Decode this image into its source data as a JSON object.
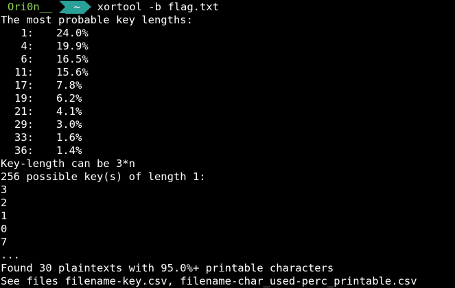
{
  "prompt": {
    "user": "Ori0n__",
    "directory": "~",
    "command": "xortool -b flag.txt"
  },
  "output": {
    "header": "The most probable key lengths:",
    "key_lengths": [
      {
        "length": "1:",
        "percent": "24.0%"
      },
      {
        "length": "4:",
        "percent": "19.9%"
      },
      {
        "length": "6:",
        "percent": "16.5%"
      },
      {
        "length": "11:",
        "percent": "15.6%"
      },
      {
        "length": "17:",
        "percent": "7.8%"
      },
      {
        "length": "19:",
        "percent": "6.2%"
      },
      {
        "length": "21:",
        "percent": "4.1%"
      },
      {
        "length": "29:",
        "percent": "3.0%"
      },
      {
        "length": "33:",
        "percent": "1.6%"
      },
      {
        "length": "36:",
        "percent": "1.4%"
      }
    ],
    "key_length_note": "Key-length can be 3*n",
    "possible_keys": "256 possible key(s) of length 1:",
    "keys": [
      "3",
      "2",
      "1",
      "0",
      "7"
    ],
    "ellipsis": "...",
    "found": "Found 30 plaintexts with 95.0%+ printable characters",
    "see_files": "See files filename-key.csv, filename-char_used-perc_printable.csv"
  },
  "colors": {
    "background": "#000000",
    "text": "#ffffff",
    "user": "#8fd14f",
    "directory_bg": "#2aa198"
  }
}
